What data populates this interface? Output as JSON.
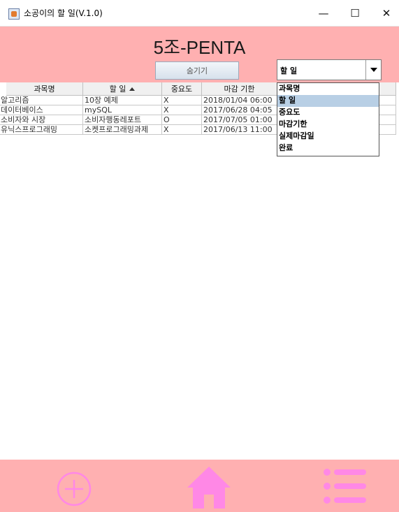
{
  "window": {
    "title": "소공이의 할 일(V.1.0)",
    "min_label": "—",
    "max_label": "☐",
    "close_label": "✕"
  },
  "header": {
    "app_title": "5조-PENTA",
    "hide_button": "숨기기",
    "sort_select_value": "할 일"
  },
  "table": {
    "columns": [
      "과목명",
      "할 일",
      "중요도",
      "마감 기한"
    ],
    "sorted_column": "할 일",
    "rows": [
      [
        "알고리즘",
        "10장 예제",
        "X",
        "2018/01/04  06:00"
      ],
      [
        "데이터베이스",
        "mySQL",
        "X",
        "2017/06/28  04:05"
      ],
      [
        "소비자와 시장",
        "소비자행동레포트",
        "O",
        "2017/07/05  01:00"
      ],
      [
        "유닉스프로그래밍",
        "소켓프로그래밍과제",
        "X",
        "2017/06/13  11:00"
      ]
    ]
  },
  "dropdown": {
    "options": [
      "과목명",
      "할 일",
      "중요도",
      "마감기한",
      "실제마감일",
      "완료"
    ],
    "selected_index": 1
  },
  "bottom_bar": {
    "icons": [
      "add-icon",
      "home-icon",
      "menu-list-icon"
    ]
  },
  "colors": {
    "accent_pink": "#ffb0b1",
    "icon_pink": "#ff88e6",
    "selected_blue": "#b8cfe5"
  }
}
